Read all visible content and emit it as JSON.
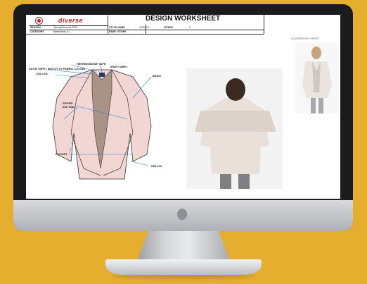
{
  "worksheet": {
    "brand": "diverse",
    "title": "DESIGN WORKSHEET",
    "season_label": "SEASON",
    "season_value": "Spring/Summer 2015",
    "category_label": "CATEGORY",
    "category_value": "Sweatshirts & L",
    "style_name_label": "STYLE NAME",
    "style_name_value": "DCEM-A",
    "base_story_label": "BASE / STORY",
    "intake_label": "INTAKE",
    "intake_value": "2",
    "illustration_label": "ILLUSTRATION / PHOTO"
  },
  "callouts": {
    "herringbone": "HERRINGBONE TAPE",
    "main_label": "MAIN LABEL",
    "satin_tape": "SATIN TAPE ( MATCH TO FABRIC COLOR)",
    "collar": "COLLAR",
    "basic": "BASIC",
    "zipper": "ZIPPER",
    "zipper_sub": "and Tape",
    "pocket": "POCKET",
    "rib": "RIB 2X2"
  },
  "colors": {
    "background": "#e6ae2e",
    "brand_red": "#c8262b",
    "jacket_pink": "#f2d6d3",
    "jacket_lining": "#a89386",
    "callout_line": "#1f8ad6"
  }
}
